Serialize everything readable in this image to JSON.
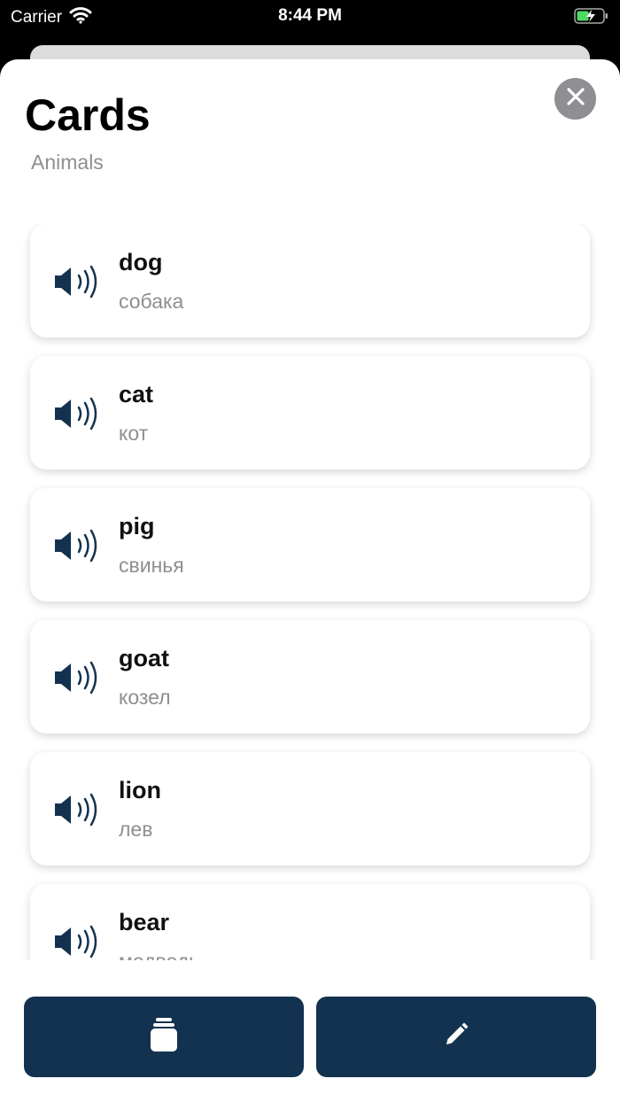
{
  "status_bar": {
    "carrier": "Carrier",
    "time": "8:44 PM",
    "battery_icon": "battery-charging-icon",
    "wifi_icon": "wifi-icon"
  },
  "header": {
    "title": "Cards",
    "subtitle": "Animals",
    "close_icon": "close-icon"
  },
  "cards": [
    {
      "word": "dog",
      "translation": "собака",
      "icon": "speaker-icon"
    },
    {
      "word": "cat",
      "translation": "кот",
      "icon": "speaker-icon"
    },
    {
      "word": "pig",
      "translation": "свинья",
      "icon": "speaker-icon"
    },
    {
      "word": "goat",
      "translation": "козел",
      "icon": "speaker-icon"
    },
    {
      "word": "lion",
      "translation": "лев",
      "icon": "speaker-icon"
    },
    {
      "word": "bear",
      "translation": "медведь",
      "icon": "speaker-icon"
    }
  ],
  "actions": {
    "cards_icon": "card-stack-icon",
    "edit_icon": "pencil-icon"
  },
  "colors": {
    "accent": "#13324f",
    "secondary_text": "#8e8e93",
    "close_button": "#8e8e93"
  }
}
